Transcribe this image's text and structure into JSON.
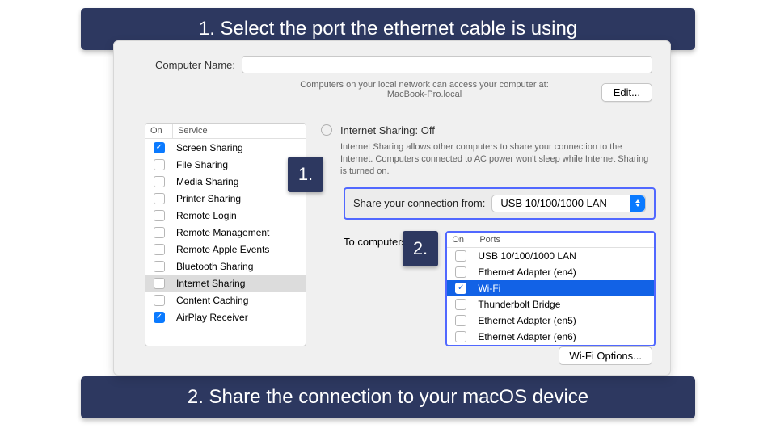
{
  "banners": {
    "top": "1.   Select the port the ethernet cable is using",
    "bottom": "2. Share the connection to your macOS device"
  },
  "callouts": {
    "one": "1.",
    "two": "2."
  },
  "computer_name": {
    "label": "Computer Name:",
    "value": "",
    "sub_line1": "Computers on your local network can access your computer at:",
    "sub_line2": "MacBook-Pro.local",
    "edit_label": "Edit..."
  },
  "services": {
    "header_on": "On",
    "header_service": "Service",
    "items": [
      {
        "label": "Screen Sharing",
        "on": true,
        "selected": false
      },
      {
        "label": "File Sharing",
        "on": false,
        "selected": false
      },
      {
        "label": "Media Sharing",
        "on": false,
        "selected": false
      },
      {
        "label": "Printer Sharing",
        "on": false,
        "selected": false
      },
      {
        "label": "Remote Login",
        "on": false,
        "selected": false
      },
      {
        "label": "Remote Management",
        "on": false,
        "selected": false
      },
      {
        "label": "Remote Apple Events",
        "on": false,
        "selected": false
      },
      {
        "label": "Bluetooth Sharing",
        "on": false,
        "selected": false
      },
      {
        "label": "Internet Sharing",
        "on": false,
        "selected": true
      },
      {
        "label": "Content Caching",
        "on": false,
        "selected": false
      },
      {
        "label": "AirPlay Receiver",
        "on": true,
        "selected": false
      }
    ]
  },
  "detail": {
    "title": "Internet Sharing: Off",
    "desc": "Internet Sharing allows other computers to share your connection to the Internet. Computers connected to AC power won't sleep while Internet Sharing is turned on.",
    "share_from_label": "Share your connection from:",
    "share_from_value": "USB 10/100/1000 LAN",
    "to_label": "To computers using:",
    "ports_header_on": "On",
    "ports_header_ports": "Ports",
    "ports": [
      {
        "label": "USB 10/100/1000 LAN",
        "on": false,
        "selected": false
      },
      {
        "label": "Ethernet Adapter (en4)",
        "on": false,
        "selected": false
      },
      {
        "label": "Wi-Fi",
        "on": true,
        "selected": true
      },
      {
        "label": "Thunderbolt Bridge",
        "on": false,
        "selected": false
      },
      {
        "label": "Ethernet Adapter (en5)",
        "on": false,
        "selected": false
      },
      {
        "label": "Ethernet Adapter (en6)",
        "on": false,
        "selected": false
      }
    ],
    "wifi_options_label": "Wi-Fi Options..."
  }
}
